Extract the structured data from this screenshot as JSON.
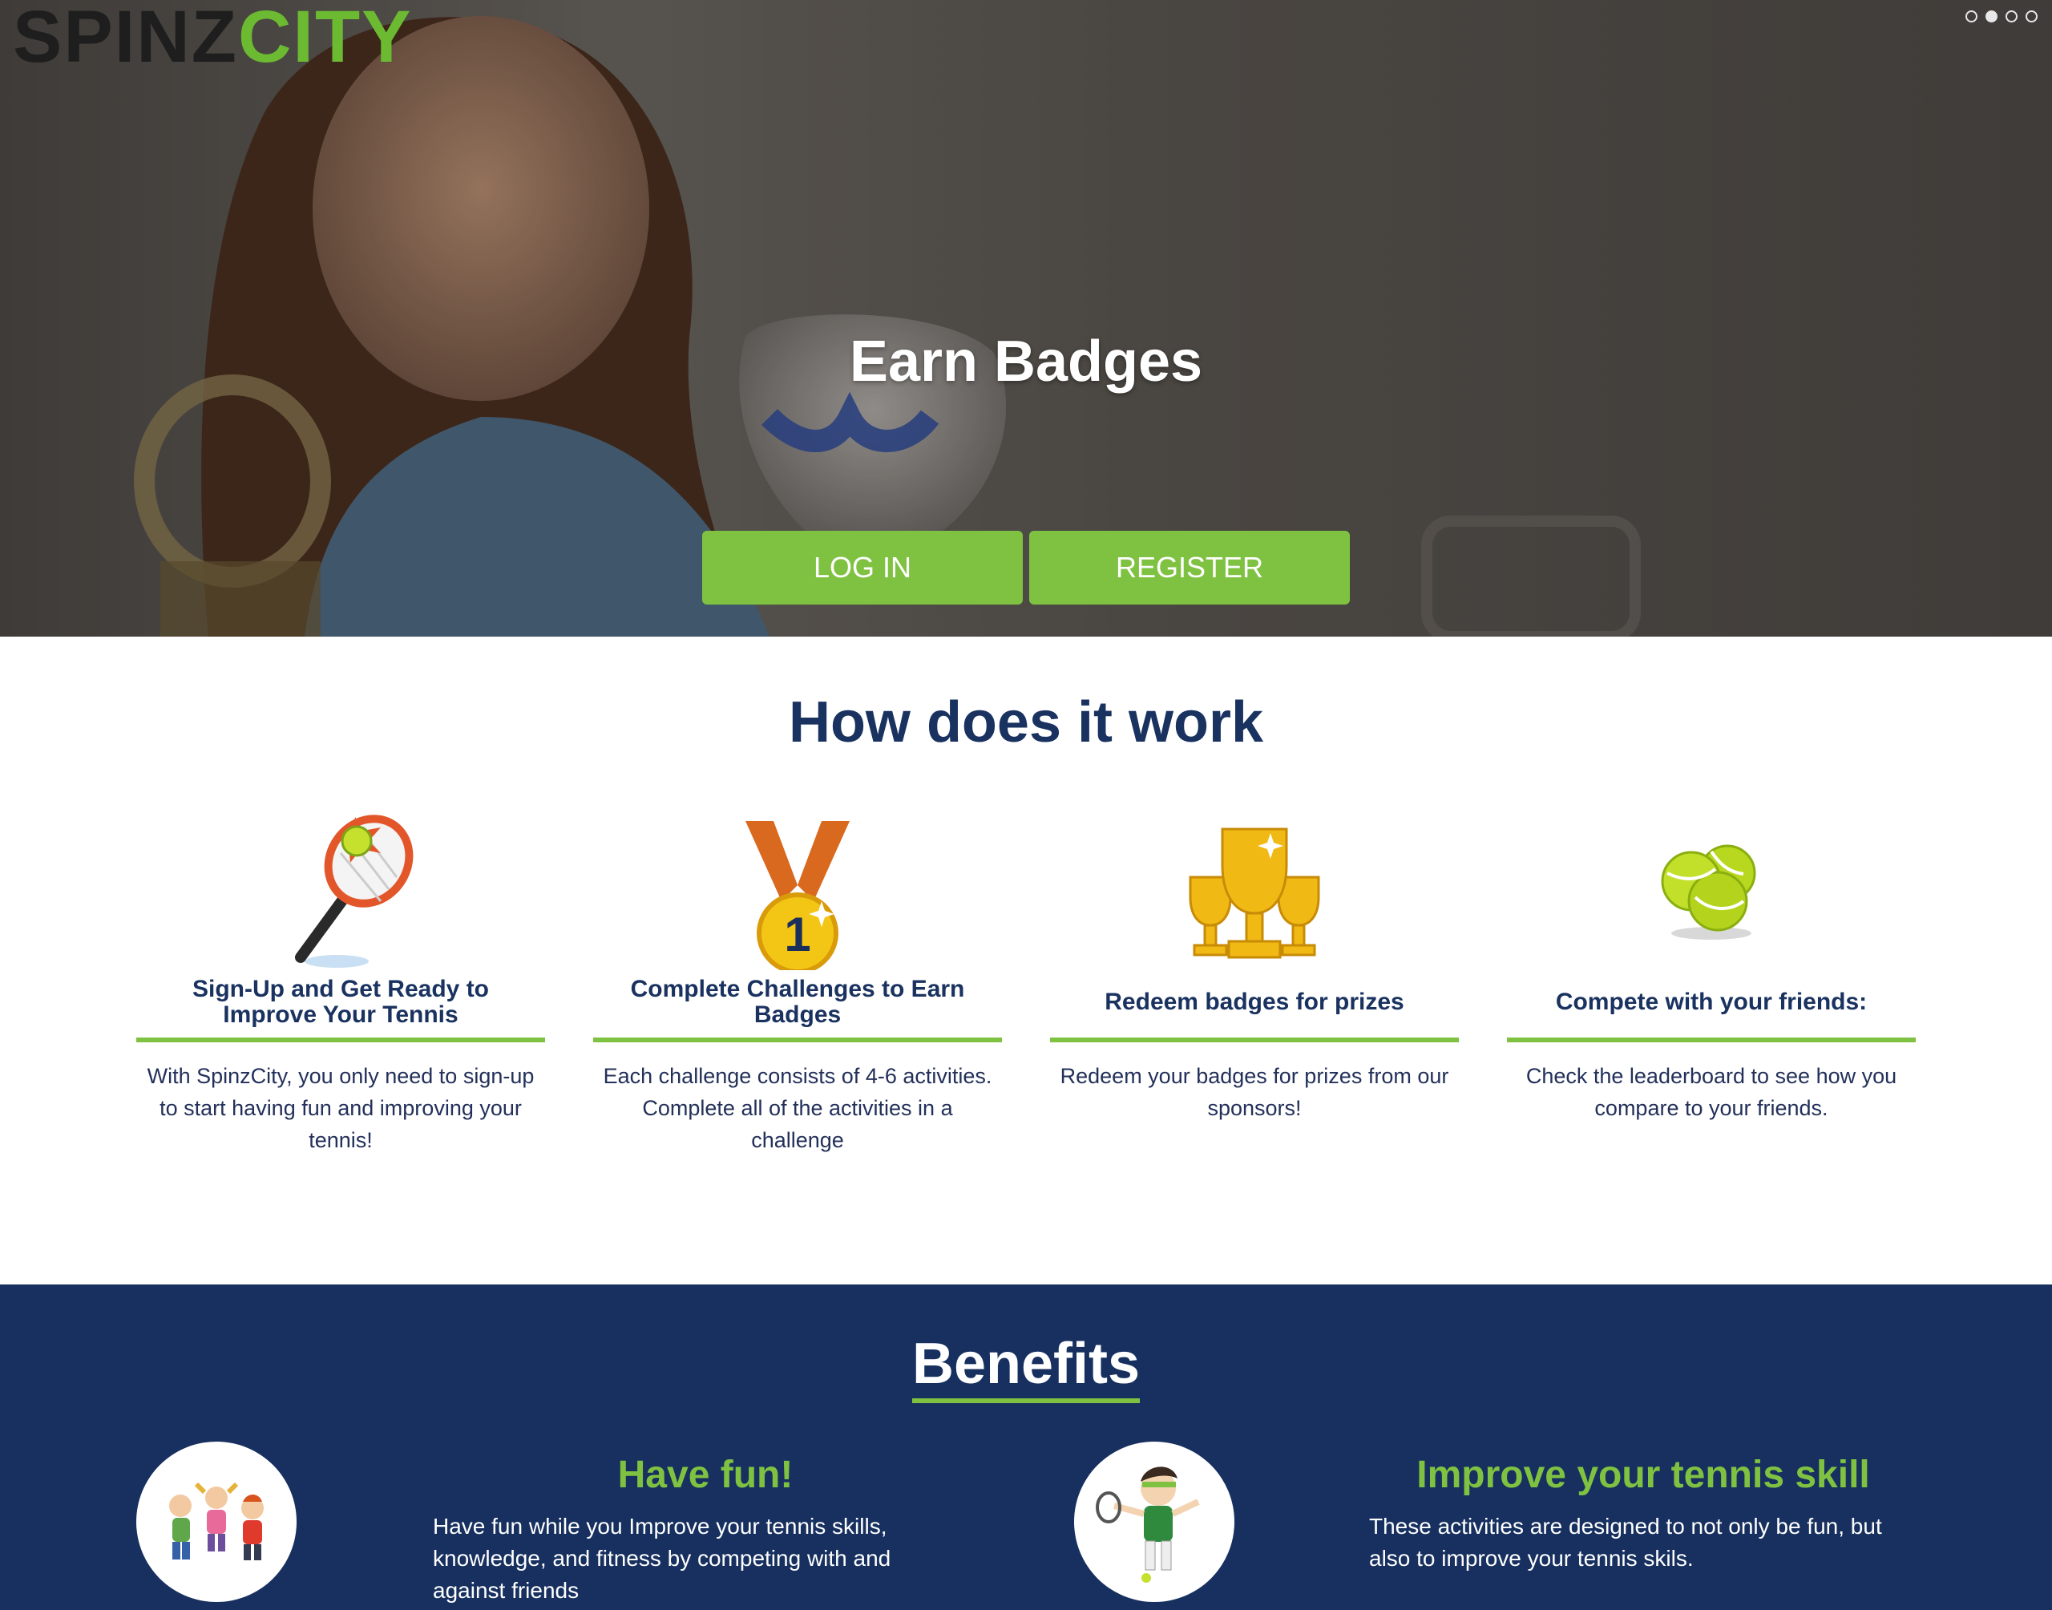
{
  "brand": {
    "logo_part1": "SPINZ",
    "logo_part2": "CITY",
    "accent": "#7fc241",
    "navy": "#17305f"
  },
  "hero": {
    "slides": 4,
    "active_slide": 2,
    "title": "Earn Badges",
    "login_label": "LOG IN",
    "register_label": "REGISTER"
  },
  "how": {
    "title": "How does it work",
    "steps": [
      {
        "icon": "tennis-racket-icon",
        "title": "Sign-Up and Get Ready to Improve Your Tennis",
        "text": "With SpinzCity, you only need to sign-up to start having fun and improving your tennis!"
      },
      {
        "icon": "medal-icon",
        "title": "Complete Challenges to Earn Badges",
        "text": "Each challenge consists of 4-6 activities. Complete all of the activities in a challenge"
      },
      {
        "icon": "trophies-icon",
        "title": "Redeem badges for prizes",
        "text": "Redeem your badges for prizes from our sponsors!"
      },
      {
        "icon": "tennis-balls-icon",
        "title": "Compete with your friends:",
        "text": "Check the leaderboard to see how you compare to your friends."
      }
    ]
  },
  "benefits": {
    "title": "Benefits",
    "items": [
      {
        "icon": "kids-jumping-icon",
        "heading": "Have fun!",
        "text": "Have fun while you Improve your tennis skills, knowledge, and fitness by competing with and against friends"
      },
      {
        "icon": "tennis-player-icon",
        "heading": "Improve your tennis skill",
        "text": "These activities are designed to not only be fun, but also to improve your tennis skils."
      }
    ]
  }
}
